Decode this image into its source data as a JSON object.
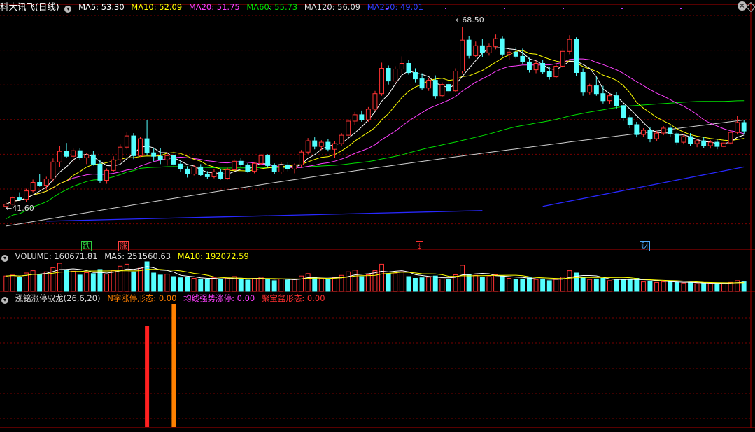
{
  "header": {
    "stock_name": "科大讯飞(日线)",
    "ma5": "MA5: 53.30",
    "ma10": "MA10: 52.09",
    "ma20": "MA20: 51.75",
    "ma60": "MA60: 55.73",
    "ma120": "MA120: 56.09",
    "ma250": "MA250: 49.01"
  },
  "volume_header": {
    "name": "VOLUME: 160671.81",
    "ma5": "MA5: 251560.63",
    "ma10": "MA10: 192072.59"
  },
  "indicator_header": {
    "name": "泓铭涨停驭龙(26,6,20)",
    "s1": "N字涨停形态: 0.00",
    "s2": "均线强势涨停: 0.00",
    "s3": "聚宝盆形态: 0.00"
  },
  "price_labels": {
    "high": "68.50",
    "low": "41.60"
  },
  "event_tags": [
    {
      "text": "跌",
      "color": "#2ecc40"
    },
    {
      "text": "涨",
      "color": "#ff4040"
    },
    {
      "text": "$",
      "color": "#ff3030"
    },
    {
      "text": "财",
      "color": "#4ea8ff"
    }
  ],
  "colors": {
    "up": "#ff3232",
    "down": "#54ffff",
    "ma5": "#ffffff",
    "ma10": "#ffff00",
    "ma20": "#ff40ff",
    "ma60": "#00e000",
    "ma120": "#d0d0d0",
    "ma250": "#2828ff",
    "grid": "#7a0000",
    "sig1": "#ff2020",
    "sig2": "#ff8000"
  },
  "chart_data": {
    "type": "candlestick",
    "price_range": [
      38.5,
      70.5
    ],
    "candles": [
      [
        43.0,
        43.6,
        42.8,
        43.3
      ],
      [
        43.3,
        44.5,
        43.0,
        44.2
      ],
      [
        44.2,
        45.0,
        43.8,
        44.0
      ],
      [
        44.0,
        45.5,
        43.6,
        45.2
      ],
      [
        45.2,
        46.8,
        45.0,
        46.4
      ],
      [
        46.4,
        47.6,
        45.8,
        46.0
      ],
      [
        46.0,
        47.2,
        45.4,
        46.9
      ],
      [
        46.9,
        49.8,
        46.5,
        49.3
      ],
      [
        49.3,
        51.6,
        48.6,
        50.8
      ],
      [
        50.8,
        52.0,
        49.9,
        50.1
      ],
      [
        50.1,
        51.2,
        49.2,
        50.9
      ],
      [
        50.9,
        51.3,
        49.6,
        49.9
      ],
      [
        49.9,
        50.6,
        49.0,
        50.3
      ],
      [
        50.3,
        50.9,
        48.8,
        49.0
      ],
      [
        49.0,
        49.6,
        46.3,
        46.7
      ],
      [
        46.7,
        48.4,
        46.2,
        48.1
      ],
      [
        48.1,
        50.1,
        47.9,
        49.6
      ],
      [
        49.6,
        51.8,
        49.3,
        51.4
      ],
      [
        51.4,
        53.6,
        51.1,
        53.0
      ],
      [
        53.0,
        53.4,
        49.7,
        50.2
      ],
      [
        50.2,
        52.9,
        50.0,
        52.6
      ],
      [
        52.6,
        55.2,
        50.3,
        50.6
      ],
      [
        50.6,
        51.3,
        49.4,
        50.1
      ],
      [
        50.1,
        51.3,
        49.0,
        49.6
      ],
      [
        49.6,
        50.7,
        48.8,
        50.2
      ],
      [
        50.2,
        50.8,
        48.7,
        49.0
      ],
      [
        49.0,
        49.5,
        47.9,
        48.3
      ],
      [
        48.3,
        48.7,
        47.1,
        47.6
      ],
      [
        47.6,
        48.9,
        47.4,
        48.6
      ],
      [
        48.6,
        49.0,
        47.3,
        47.5
      ],
      [
        47.5,
        48.0,
        46.9,
        47.2
      ],
      [
        47.2,
        48.3,
        47.0,
        47.9
      ],
      [
        47.9,
        48.3,
        46.8,
        47.0
      ],
      [
        47.0,
        48.5,
        46.8,
        48.2
      ],
      [
        48.2,
        49.7,
        47.9,
        49.4
      ],
      [
        49.4,
        49.9,
        48.6,
        48.9
      ],
      [
        48.9,
        49.1,
        47.8,
        48.0
      ],
      [
        48.0,
        49.3,
        47.7,
        49.1
      ],
      [
        49.1,
        50.4,
        48.9,
        50.2
      ],
      [
        50.2,
        50.4,
        48.5,
        48.8
      ],
      [
        48.8,
        49.1,
        47.6,
        47.9
      ],
      [
        47.9,
        49.3,
        47.6,
        48.9
      ],
      [
        48.9,
        49.3,
        48.0,
        48.3
      ],
      [
        48.3,
        49.1,
        47.7,
        48.9
      ],
      [
        48.9,
        51.0,
        48.6,
        50.7
      ],
      [
        50.7,
        52.7,
        50.4,
        52.3
      ],
      [
        52.3,
        52.8,
        51.1,
        51.5
      ],
      [
        51.5,
        52.4,
        51.0,
        52.1
      ],
      [
        52.1,
        52.6,
        50.8,
        51.1
      ],
      [
        51.1,
        52.3,
        49.9,
        51.9
      ],
      [
        51.9,
        53.4,
        51.6,
        53.1
      ],
      [
        53.1,
        55.4,
        52.8,
        55.1
      ],
      [
        55.1,
        56.4,
        54.5,
        56.0
      ],
      [
        56.0,
        56.6,
        55.0,
        55.3
      ],
      [
        55.3,
        57.1,
        55.0,
        56.8
      ],
      [
        56.8,
        59.4,
        56.5,
        59.0
      ],
      [
        59.0,
        63.4,
        58.7,
        62.6
      ],
      [
        62.6,
        63.0,
        60.3,
        60.8
      ],
      [
        60.8,
        62.9,
        60.5,
        62.5
      ],
      [
        62.5,
        64.3,
        61.8,
        63.3
      ],
      [
        63.3,
        63.8,
        61.7,
        62.0
      ],
      [
        62.0,
        62.6,
        60.6,
        61.1
      ],
      [
        61.1,
        61.9,
        59.5,
        59.8
      ],
      [
        59.8,
        61.2,
        59.4,
        60.9
      ],
      [
        60.9,
        61.6,
        58.3,
        58.7
      ],
      [
        58.7,
        60.6,
        58.5,
        60.3
      ],
      [
        60.3,
        60.8,
        59.1,
        59.4
      ],
      [
        59.4,
        62.6,
        59.2,
        62.2
      ],
      [
        62.2,
        68.5,
        61.9,
        66.6
      ],
      [
        66.6,
        67.2,
        64.0,
        64.4
      ],
      [
        64.4,
        66.4,
        64.2,
        65.8
      ],
      [
        65.8,
        66.8,
        64.2,
        64.8
      ],
      [
        64.8,
        66.1,
        64.4,
        65.7
      ],
      [
        65.7,
        67.4,
        65.3,
        66.8
      ],
      [
        66.8,
        67.1,
        64.3,
        64.6
      ],
      [
        64.6,
        65.3,
        63.8,
        64.9
      ],
      [
        64.9,
        65.6,
        64.0,
        64.3
      ],
      [
        64.3,
        65.4,
        63.2,
        63.5
      ],
      [
        63.5,
        64.1,
        62.0,
        62.4
      ],
      [
        62.4,
        63.7,
        61.9,
        63.3
      ],
      [
        63.3,
        63.8,
        61.8,
        62.1
      ],
      [
        62.1,
        62.8,
        61.0,
        61.4
      ],
      [
        61.4,
        63.2,
        61.2,
        62.9
      ],
      [
        62.9,
        65.4,
        62.7,
        65.0
      ],
      [
        65.0,
        67.3,
        64.6,
        66.7
      ],
      [
        66.7,
        67.0,
        61.5,
        62.0
      ],
      [
        62.0,
        62.6,
        58.7,
        59.2
      ],
      [
        59.2,
        60.4,
        58.9,
        60.1
      ],
      [
        60.1,
        61.4,
        58.7,
        59.0
      ],
      [
        59.0,
        60.1,
        57.6,
        58.0
      ],
      [
        58.0,
        59.0,
        57.5,
        58.7
      ],
      [
        58.7,
        59.2,
        56.8,
        57.3
      ],
      [
        57.3,
        57.6,
        55.1,
        55.6
      ],
      [
        55.6,
        56.0,
        54.1,
        54.6
      ],
      [
        54.6,
        55.0,
        52.8,
        53.2
      ],
      [
        53.2,
        54.1,
        52.9,
        53.8
      ],
      [
        53.8,
        54.2,
        52.1,
        52.6
      ],
      [
        52.6,
        53.7,
        52.3,
        53.4
      ],
      [
        53.4,
        54.4,
        53.1,
        54.1
      ],
      [
        54.1,
        54.6,
        52.9,
        53.3
      ],
      [
        53.3,
        53.6,
        51.7,
        52.1
      ],
      [
        52.1,
        53.2,
        51.8,
        52.9
      ],
      [
        52.9,
        53.4,
        51.6,
        51.9
      ],
      [
        51.9,
        52.6,
        51.4,
        52.3
      ],
      [
        52.3,
        52.8,
        51.3,
        51.6
      ],
      [
        51.6,
        52.4,
        51.2,
        52.1
      ],
      [
        52.1,
        52.6,
        51.1,
        51.5
      ],
      [
        51.5,
        52.3,
        51.2,
        52.0
      ],
      [
        52.0,
        53.8,
        51.8,
        53.5
      ],
      [
        53.5,
        55.8,
        53.2,
        54.9
      ],
      [
        54.9,
        55.2,
        53.3,
        53.7
      ]
    ],
    "volume": [
      0.52,
      0.55,
      0.48,
      0.62,
      0.7,
      0.58,
      0.66,
      0.8,
      0.95,
      0.72,
      0.68,
      0.55,
      0.63,
      0.6,
      0.74,
      0.58,
      0.7,
      0.85,
      0.92,
      0.66,
      0.78,
      1.0,
      0.62,
      0.55,
      0.58,
      0.5,
      0.46,
      0.48,
      0.44,
      0.42,
      0.4,
      0.46,
      0.41,
      0.45,
      0.5,
      0.42,
      0.38,
      0.44,
      0.48,
      0.4,
      0.36,
      0.42,
      0.38,
      0.4,
      0.52,
      0.6,
      0.46,
      0.44,
      0.4,
      0.46,
      0.54,
      0.66,
      0.72,
      0.5,
      0.56,
      0.7,
      0.92,
      0.6,
      0.62,
      0.66,
      0.5,
      0.44,
      0.46,
      0.48,
      0.52,
      0.42,
      0.4,
      0.56,
      0.88,
      0.58,
      0.54,
      0.48,
      0.5,
      0.56,
      0.52,
      0.44,
      0.4,
      0.42,
      0.46,
      0.4,
      0.42,
      0.36,
      0.4,
      0.48,
      0.7,
      0.62,
      0.48,
      0.4,
      0.42,
      0.44,
      0.36,
      0.38,
      0.4,
      0.42,
      0.44,
      0.32,
      0.34,
      0.3,
      0.32,
      0.34,
      0.3,
      0.28,
      0.3,
      0.26,
      0.28,
      0.26,
      0.28,
      0.26,
      0.3,
      0.36,
      0.32
    ],
    "signals": [
      {
        "name": "N字涨停形态",
        "bar_index": 21,
        "value": 0.82
      },
      {
        "name": "均线强势涨停",
        "bar_index": 25,
        "value": 1.0
      }
    ],
    "ma250_partial": [
      [
        6,
        40.9
      ],
      [
        71,
        42.4
      ]
    ],
    "ma250_tail": [
      [
        80,
        43.0
      ],
      [
        110,
        48.6
      ]
    ]
  }
}
